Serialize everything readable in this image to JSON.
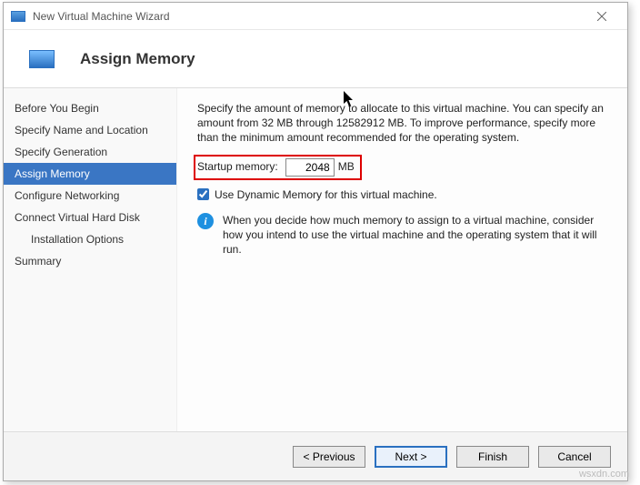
{
  "window": {
    "title": "New Virtual Machine Wizard"
  },
  "header": {
    "title": "Assign Memory"
  },
  "sidebar": {
    "items": [
      {
        "label": "Before You Begin"
      },
      {
        "label": "Specify Name and Location"
      },
      {
        "label": "Specify Generation"
      },
      {
        "label": "Assign Memory"
      },
      {
        "label": "Configure Networking"
      },
      {
        "label": "Connect Virtual Hard Disk"
      },
      {
        "label": "Installation Options"
      },
      {
        "label": "Summary"
      }
    ]
  },
  "content": {
    "description": "Specify the amount of memory to allocate to this virtual machine. You can specify an amount from 32 MB through 12582912 MB. To improve performance, specify more than the minimum amount recommended for the operating system.",
    "mem_label": "Startup memory:",
    "mem_value": "2048",
    "mem_unit": "MB",
    "dynamic_label": "Use Dynamic Memory for this virtual machine.",
    "info_text": "When you decide how much memory to assign to a virtual machine, consider how you intend to use the virtual machine and the operating system that it will run."
  },
  "footer": {
    "previous": "< Previous",
    "next": "Next >",
    "finish": "Finish",
    "cancel": "Cancel"
  },
  "watermark": "wsxdn.com"
}
